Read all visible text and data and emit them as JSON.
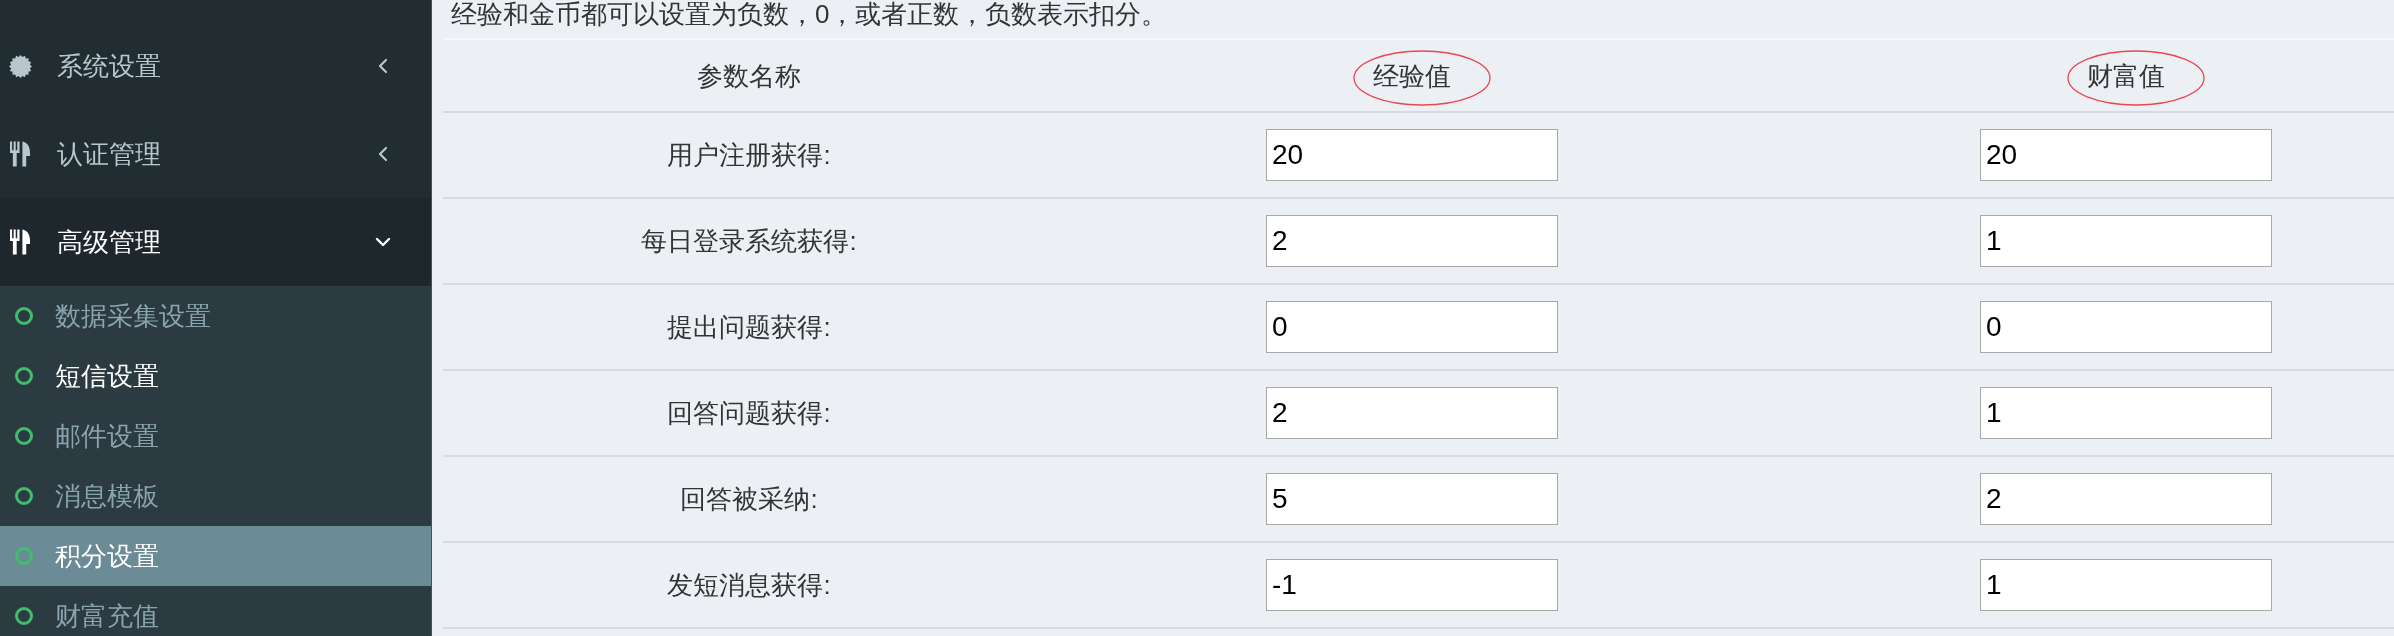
{
  "sidebar": {
    "menu": [
      {
        "kind": "seal",
        "label": "系统设置",
        "expanded": false
      },
      {
        "kind": "cutlery",
        "label": "认证管理",
        "expanded": false
      },
      {
        "kind": "cutlery",
        "label": "高级管理",
        "expanded": true,
        "children": [
          {
            "label": "数据采集设置",
            "selected": false,
            "hovered": false
          },
          {
            "label": "短信设置",
            "selected": false,
            "hovered": true
          },
          {
            "label": "邮件设置",
            "selected": false,
            "hovered": false
          },
          {
            "label": "消息模板",
            "selected": false,
            "hovered": false
          },
          {
            "label": "积分设置",
            "selected": true,
            "hovered": false
          },
          {
            "label": "财富充值",
            "selected": false,
            "hovered": false
          }
        ]
      }
    ]
  },
  "main": {
    "note": "经验和金币都可以设置为负数，0，或者正数，负数表示扣分。",
    "table": {
      "columns": [
        {
          "label": "参数名称",
          "circled": false
        },
        {
          "label": "经验值",
          "circled": true
        },
        {
          "label": "财富值",
          "circled": true
        }
      ],
      "rows": [
        {
          "label": "用户注册获得:",
          "values": [
            "20",
            "20"
          ]
        },
        {
          "label": "每日登录系统获得:",
          "values": [
            "2",
            "1"
          ]
        },
        {
          "label": "提出问题获得:",
          "values": [
            "0",
            "0"
          ]
        },
        {
          "label": "回答问题获得:",
          "values": [
            "2",
            "1"
          ]
        },
        {
          "label": "回答被采纳:",
          "values": [
            "5",
            "2"
          ]
        },
        {
          "label": "发短消息获得:",
          "values": [
            "-1",
            "1"
          ]
        }
      ]
    }
  }
}
